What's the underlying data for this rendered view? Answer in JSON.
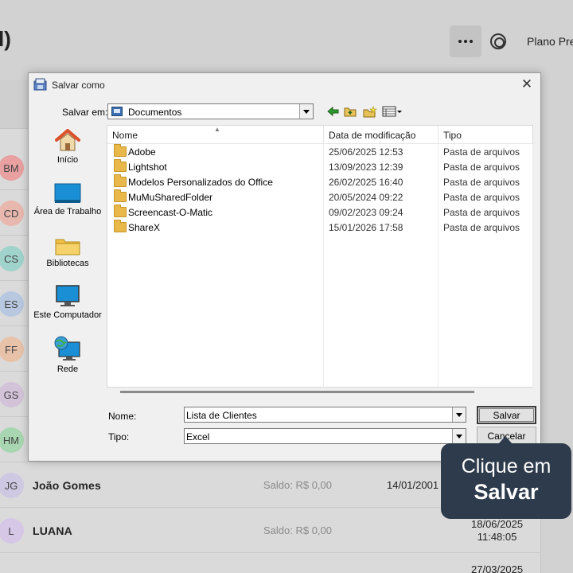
{
  "background": {
    "title_fragment": "l)",
    "plano_text": "Plano Pre",
    "rows": [
      {
        "initials": "BM",
        "color": "#e8a0a0",
        "name": "",
        "saldo": "",
        "date": ""
      },
      {
        "initials": "CD",
        "color": "#e8b7ae",
        "name": "",
        "saldo": "",
        "date": ""
      },
      {
        "initials": "CS",
        "color": "#9fd3cb",
        "name": "",
        "saldo": "",
        "date": ""
      },
      {
        "initials": "ES",
        "color": "#b8c8e0",
        "name": "",
        "saldo": "",
        "date": ""
      },
      {
        "initials": "FF",
        "color": "#e8c2a8",
        "name": "",
        "saldo": "",
        "date": ""
      },
      {
        "initials": "GS",
        "color": "#d3c3d8",
        "name": "",
        "saldo": "",
        "date": ""
      },
      {
        "initials": "HM",
        "color": "#a8d6b0",
        "name": "",
        "saldo": "",
        "date": ""
      },
      {
        "initials": "JG",
        "color": "#cfc8e3",
        "name": "João Gomes",
        "saldo": "Saldo: R$ 0,00",
        "date": "14/01/2001"
      },
      {
        "initials": "L",
        "color": "#d7c7e6",
        "name": "LUANA",
        "saldo": "Saldo: R$ 0,00",
        "date": "18/06/2025",
        "time": "11:48:05"
      },
      {
        "initials": "",
        "color": "#dadada",
        "name": "",
        "saldo": "",
        "date": "27/03/2025"
      }
    ]
  },
  "dialog": {
    "title": "Salvar como",
    "save_in_label": "Salvar em:",
    "save_in_value": "Documentos",
    "places": [
      {
        "label": "Início",
        "icon": "home-icon"
      },
      {
        "label": "Área de Trabalho",
        "icon": "desktop-icon"
      },
      {
        "label": "Bibliotecas",
        "icon": "libraries-icon"
      },
      {
        "label": "Este Computador",
        "icon": "computer-icon"
      },
      {
        "label": "Rede",
        "icon": "network-icon"
      }
    ],
    "columns": {
      "name": "Nome",
      "date": "Data de modificação",
      "type": "Tipo"
    },
    "files": [
      {
        "name": "Adobe",
        "date": "25/06/2025 12:53",
        "type": "Pasta de arquivos"
      },
      {
        "name": "Lightshot",
        "date": "13/09/2023 12:39",
        "type": "Pasta de arquivos"
      },
      {
        "name": "Modelos Personalizados do Office",
        "date": "26/02/2025 16:40",
        "type": "Pasta de arquivos"
      },
      {
        "name": "MuMuSharedFolder",
        "date": "20/05/2024 09:22",
        "type": "Pasta de arquivos"
      },
      {
        "name": "Screencast-O-Matic",
        "date": "09/02/2023 09:24",
        "type": "Pasta de arquivos"
      },
      {
        "name": "ShareX",
        "date": "15/01/2026 17:58",
        "type": "Pasta de arquivos"
      }
    ],
    "filename_label": "Nome:",
    "filename_value": "Lista de Clientes",
    "filetype_label": "Tipo:",
    "filetype_value": "Excel",
    "save_button": "Salvar",
    "cancel_button": "Cancelar"
  },
  "callout": {
    "line1": "Clique em",
    "line2": "Salvar"
  }
}
